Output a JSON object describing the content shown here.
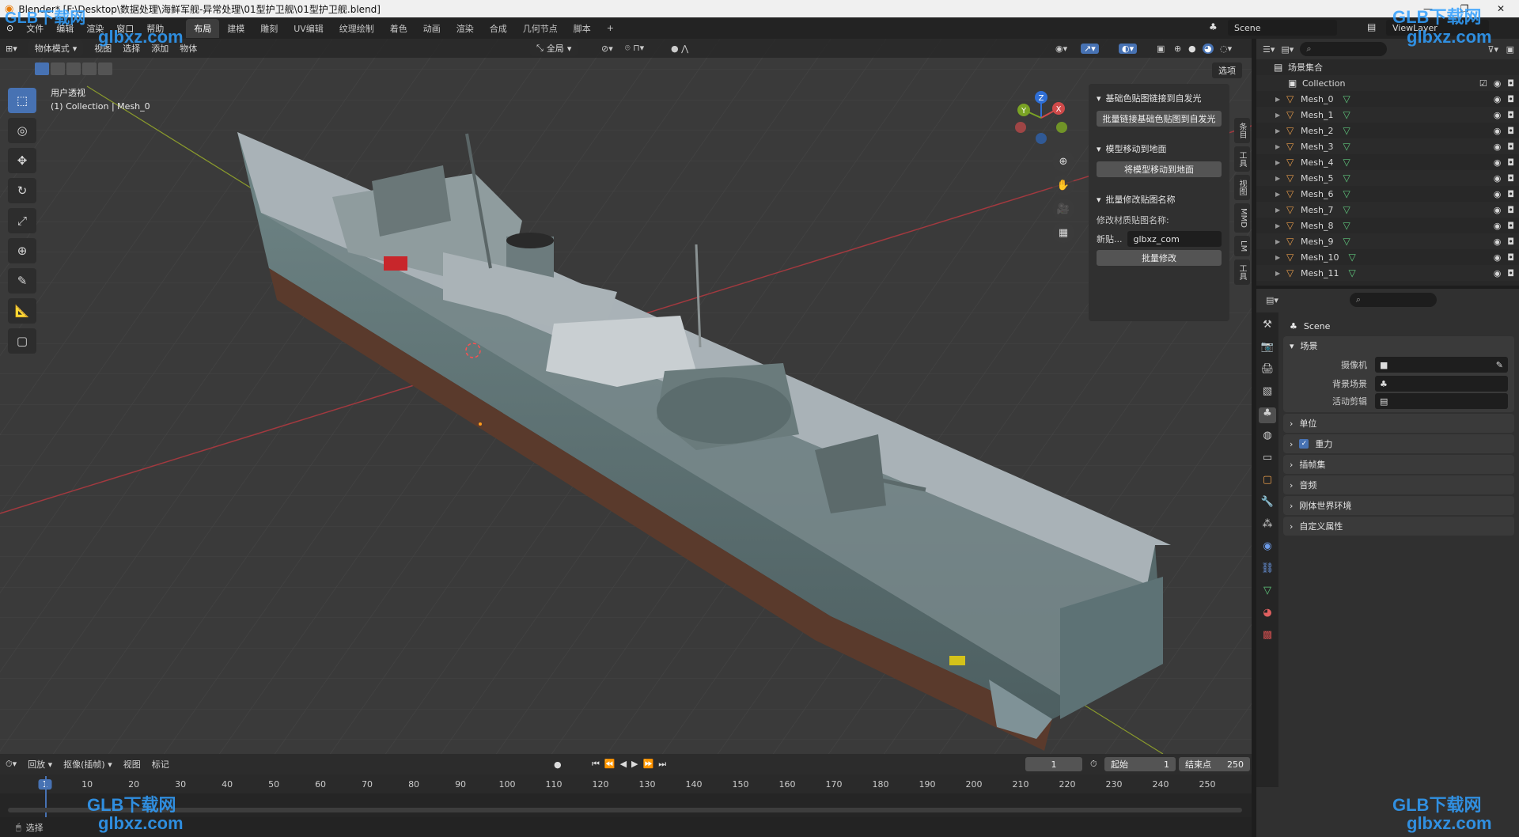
{
  "window": {
    "title": "Blender* [F:\\Desktop\\数据处理\\海鲜军舰-异常处理\\01型护卫舰\\01型护卫舰.blend]",
    "controls": [
      "—",
      "❐",
      "✕"
    ]
  },
  "menu": {
    "items": [
      "文件",
      "编辑",
      "渲染",
      "窗口",
      "帮助"
    ],
    "workspaces": [
      "布局",
      "建模",
      "雕刻",
      "UV编辑",
      "纹理绘制",
      "着色",
      "动画",
      "渲染",
      "合成",
      "几何节点",
      "脚本",
      "+"
    ],
    "active_workspace": "布局",
    "scene": "Scene",
    "view_layer": "ViewLayer"
  },
  "viewport": {
    "mode": "物体模式",
    "menus": [
      "视图",
      "选择",
      "添加",
      "物体"
    ],
    "transform_orientation": "全局",
    "options": "选项",
    "overlay_line1": "用户透视",
    "overlay_line2": "(1) Collection | Mesh_0",
    "gizmo_labels": {
      "z": "Z",
      "y": "Y",
      "x": "X"
    }
  },
  "npanel": {
    "section1_title": "基础色贴图链接到自发光",
    "section1_button": "批量链接基础色贴图到自发光",
    "section2_title": "模型移动到地面",
    "section2_button": "将模型移动到地面",
    "section3_title": "批量修改贴图名称",
    "section3_label": "修改材质贴图名称:",
    "new_name_label": "新贴...",
    "new_name_value": "glbxz_com",
    "section3_button": "批量修改",
    "side_tabs": [
      "条目",
      "工具",
      "视图",
      "MMD",
      "LM",
      "工具"
    ]
  },
  "outliner": {
    "root": "场景集合",
    "collection": "Collection",
    "objects": [
      "Mesh_0",
      "Mesh_1",
      "Mesh_2",
      "Mesh_3",
      "Mesh_4",
      "Mesh_5",
      "Mesh_6",
      "Mesh_7",
      "Mesh_8",
      "Mesh_9",
      "Mesh_10",
      "Mesh_11"
    ]
  },
  "properties": {
    "context": "Scene",
    "panel_scene": "场景",
    "camera_label": "摄像机",
    "bg_scene_label": "背景场景",
    "active_clip_label": "活动剪辑",
    "panels": [
      "单位",
      "重力",
      "插帧集",
      "音频",
      "刚体世界环境",
      "自定义属性"
    ]
  },
  "timeline": {
    "menus": [
      "回放",
      "抠像(插帧)",
      "视图",
      "标记"
    ],
    "current_frame": "1",
    "start_label": "起始",
    "start": "1",
    "end_label": "结束点",
    "end": "250",
    "ticks": [
      "1",
      "10",
      "20",
      "30",
      "40",
      "50",
      "60",
      "70",
      "80",
      "90",
      "100",
      "110",
      "120",
      "130",
      "140",
      "150",
      "160",
      "170",
      "180",
      "190",
      "200",
      "210",
      "220",
      "230",
      "240",
      "250"
    ]
  },
  "statusbar": {
    "text": "选择"
  },
  "watermarks": [
    "GLB下载网",
    "glbxz.com"
  ],
  "colors": {
    "accent": "#4772b3",
    "viewport_bg": "#393939",
    "mesh_object": "#e49a4a",
    "mesh_data": "#5fc67c",
    "watermark": "#31a0ff"
  }
}
